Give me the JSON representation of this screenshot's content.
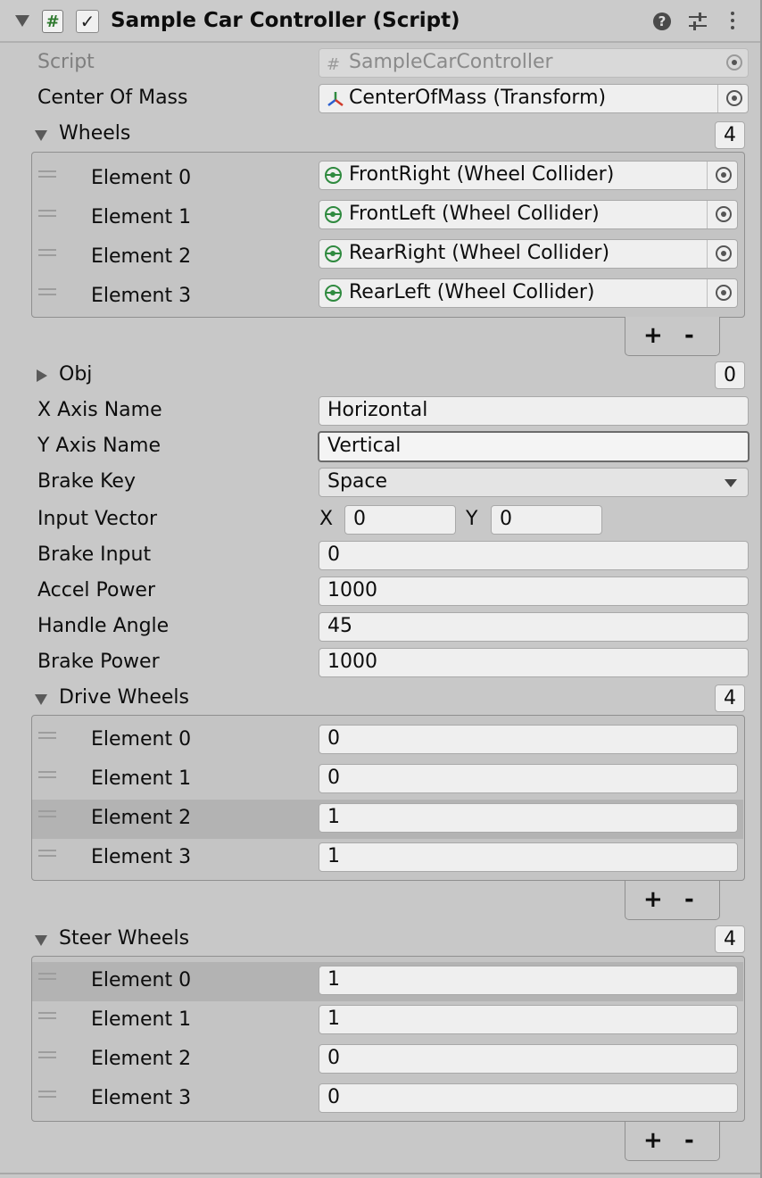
{
  "component": {
    "title": "Sample Car Controller (Script)",
    "enabled_check": "✓",
    "hash": "#"
  },
  "fields": {
    "script": {
      "label": "Script",
      "value": "SampleCarController"
    },
    "center_of_mass": {
      "label": "Center Of Mass",
      "value": "CenterOfMass (Transform)"
    },
    "wheels": {
      "label": "Wheels",
      "count": "4",
      "elements": [
        {
          "label": "Element 0",
          "value": "FrontRight (Wheel Collider)"
        },
        {
          "label": "Element 1",
          "value": "FrontLeft (Wheel Collider)"
        },
        {
          "label": "Element 2",
          "value": "RearRight (Wheel Collider)"
        },
        {
          "label": "Element 3",
          "value": "RearLeft (Wheel Collider)"
        }
      ]
    },
    "obj": {
      "label": "Obj",
      "count": "0"
    },
    "x_axis_name": {
      "label": "X Axis Name",
      "value": "Horizontal"
    },
    "y_axis_name": {
      "label": "Y Axis Name",
      "value": "Vertical"
    },
    "brake_key": {
      "label": "Brake Key",
      "value": "Space"
    },
    "input_vector": {
      "label": "Input Vector",
      "x_label": "X",
      "x_value": "0",
      "y_label": "Y",
      "y_value": "0"
    },
    "brake_input": {
      "label": "Brake Input",
      "value": "0"
    },
    "accel_power": {
      "label": "Accel Power",
      "value": "1000"
    },
    "handle_angle": {
      "label": "Handle Angle",
      "value": "45"
    },
    "brake_power": {
      "label": "Brake Power",
      "value": "1000"
    },
    "drive_wheels": {
      "label": "Drive Wheels",
      "count": "4",
      "elements": [
        {
          "label": "Element 0",
          "value": "0"
        },
        {
          "label": "Element 1",
          "value": "0"
        },
        {
          "label": "Element 2",
          "value": "1"
        },
        {
          "label": "Element 3",
          "value": "1"
        }
      ]
    },
    "steer_wheels": {
      "label": "Steer Wheels",
      "count": "4",
      "elements": [
        {
          "label": "Element 0",
          "value": "1"
        },
        {
          "label": "Element 1",
          "value": "1"
        },
        {
          "label": "Element 2",
          "value": "0"
        },
        {
          "label": "Element 3",
          "value": "0"
        }
      ]
    }
  },
  "list_buttons": {
    "add": "+",
    "remove": "-"
  },
  "icons": {
    "help": "?",
    "accent_green": "#2f8a3f"
  }
}
